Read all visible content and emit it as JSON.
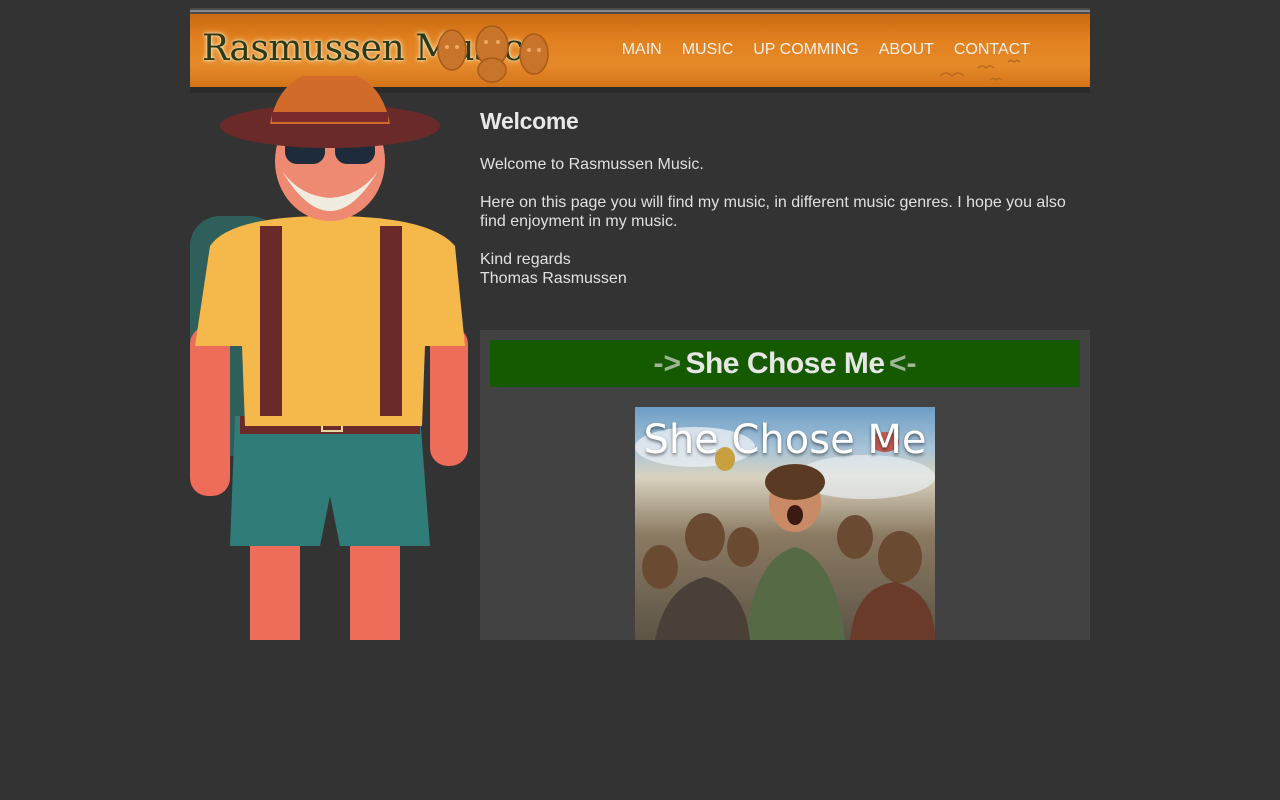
{
  "header": {
    "logo_text": "Rasmussen Music",
    "nav": [
      "MAIN",
      "MUSIC",
      "UP COMMING",
      "ABOUT",
      "CONTACT"
    ]
  },
  "content": {
    "title": "Welcome",
    "intro": "Welcome to Rasmussen Music.",
    "body": "Here on this page you will find my music, in different music genres. I hope you also find enjoyment in my music.",
    "sign_1": "Kind regards",
    "sign_2": "Thomas Rasmussen"
  },
  "feature": {
    "arrow_left": "->",
    "title": "She Chose Me",
    "arrow_right": "<-",
    "cover_title": "She Chose Me"
  },
  "colors": {
    "background": "#333333",
    "header_orange": "#e2801f",
    "feature_bar": "#155a00",
    "feature_panel": "#424242"
  }
}
